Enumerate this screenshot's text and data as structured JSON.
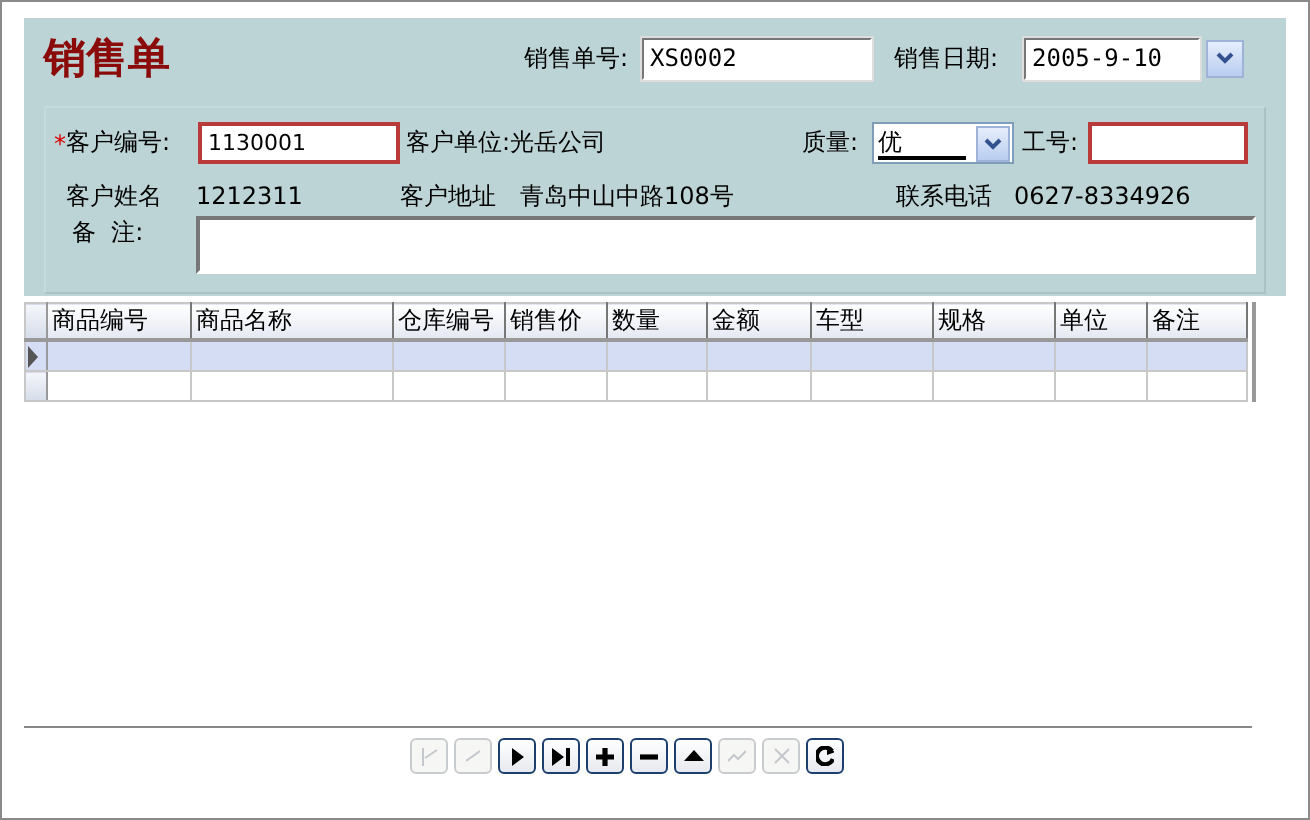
{
  "title": "销售单",
  "order_no": {
    "label": "销售单号:",
    "value": "XS0002"
  },
  "sale_date": {
    "label": "销售日期:",
    "value": "2005-9-10"
  },
  "customer_code": {
    "required_mark": "*",
    "label": "客户编号:",
    "value": "1130001"
  },
  "customer_unit": "客户单位:光岳公司",
  "quality": {
    "label": "质量:",
    "value": "优"
  },
  "worker_no": {
    "label": "工号:"
  },
  "customer_name": {
    "label": "客户姓名",
    "value": "1212311"
  },
  "customer_address": {
    "label": "客户地址",
    "value": "青岛中山中路108号"
  },
  "phone": {
    "label": "联系电话",
    "value": "0627-8334926"
  },
  "remarks": {
    "label": "备  注:"
  },
  "table": {
    "columns": [
      "商品编号",
      "商品名称",
      "仓库编号",
      "销售价",
      "数量",
      "金额",
      "车型",
      "规格",
      "单位",
      "备注"
    ],
    "rows": [
      {
        "selected": true
      },
      {
        "selected": false
      }
    ]
  },
  "navigator": [
    {
      "kind": "first",
      "disabled": true
    },
    {
      "kind": "prior",
      "disabled": true
    },
    {
      "kind": "next",
      "disabled": false
    },
    {
      "kind": "last",
      "disabled": false
    },
    {
      "kind": "insert",
      "disabled": false
    },
    {
      "kind": "delete",
      "disabled": false
    },
    {
      "kind": "edit",
      "disabled": false
    },
    {
      "kind": "post",
      "disabled": true
    },
    {
      "kind": "cancel",
      "disabled": true
    },
    {
      "kind": "refresh",
      "disabled": false
    }
  ]
}
